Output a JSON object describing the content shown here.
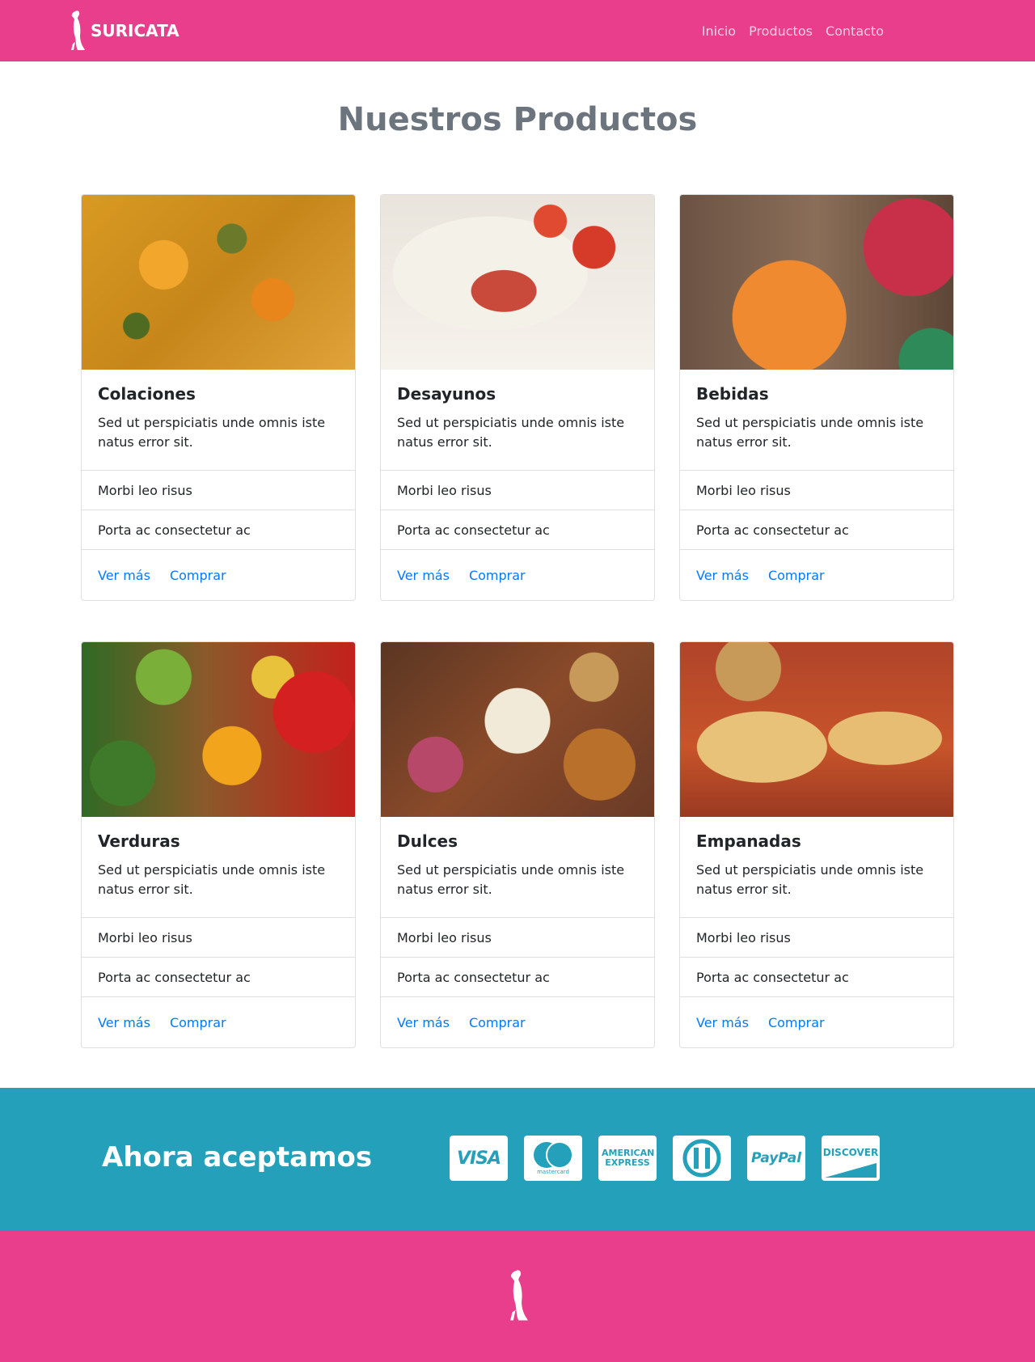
{
  "brand": {
    "name": "SURICATA",
    "logo_icon": "meerkat-icon"
  },
  "nav": {
    "items": [
      {
        "label": "Inicio"
      },
      {
        "label": "Productos"
      },
      {
        "label": "Contacto"
      }
    ]
  },
  "page": {
    "title": "Nuestros Productos"
  },
  "cards": [
    {
      "title": "Colaciones",
      "text": "Sed ut perspiciatis unde omnis iste natus error sit.",
      "list": [
        "Morbi leo risus",
        "Porta ac consectetur ac"
      ],
      "link_more": "Ver más",
      "link_buy": "Comprar",
      "image": "stew-photo"
    },
    {
      "title": "Desayunos",
      "text": "Sed ut perspiciatis unde omnis iste natus error sit.",
      "list": [
        "Morbi leo risus",
        "Porta ac consectetur ac"
      ],
      "link_more": "Ver más",
      "link_buy": "Comprar",
      "image": "sandwich-photo"
    },
    {
      "title": "Bebidas",
      "text": "Sed ut perspiciatis unde omnis iste natus error sit.",
      "list": [
        "Morbi leo risus",
        "Porta ac consectetur ac"
      ],
      "link_more": "Ver más",
      "link_buy": "Comprar",
      "image": "drinks-photo"
    },
    {
      "title": "Verduras",
      "text": "Sed ut perspiciatis unde omnis iste natus error sit.",
      "list": [
        "Morbi leo risus",
        "Porta ac consectetur ac"
      ],
      "link_more": "Ver más",
      "link_buy": "Comprar",
      "image": "vegetables-photo"
    },
    {
      "title": "Dulces",
      "text": "Sed ut perspiciatis unde omnis iste natus error sit.",
      "list": [
        "Morbi leo risus",
        "Porta ac consectetur ac"
      ],
      "link_more": "Ver más",
      "link_buy": "Comprar",
      "image": "sweets-photo"
    },
    {
      "title": "Empanadas",
      "text": "Sed ut perspiciatis unde omnis iste natus error sit.",
      "list": [
        "Morbi leo risus",
        "Porta ac consectetur ac"
      ],
      "link_more": "Ver más",
      "link_buy": "Comprar",
      "image": "empanadas-photo"
    }
  ],
  "payments": {
    "heading": "Ahora aceptamos",
    "methods": [
      {
        "label": "VISA",
        "icon": "visa-icon"
      },
      {
        "label": "mastercard",
        "icon": "mastercard-icon"
      },
      {
        "label": "AMERICAN EXPRESS",
        "icon": "amex-icon"
      },
      {
        "label": "",
        "icon": "diners-icon"
      },
      {
        "label": "PayPal",
        "icon": "paypal-icon"
      },
      {
        "label": "DISCOVER",
        "icon": "discover-icon"
      }
    ]
  },
  "colors": {
    "primary": "#e83e8c",
    "accent": "#25a0ba",
    "link": "#007bff",
    "title_gray": "#6c757d"
  },
  "footer": {
    "logo_icon": "meerkat-icon"
  }
}
